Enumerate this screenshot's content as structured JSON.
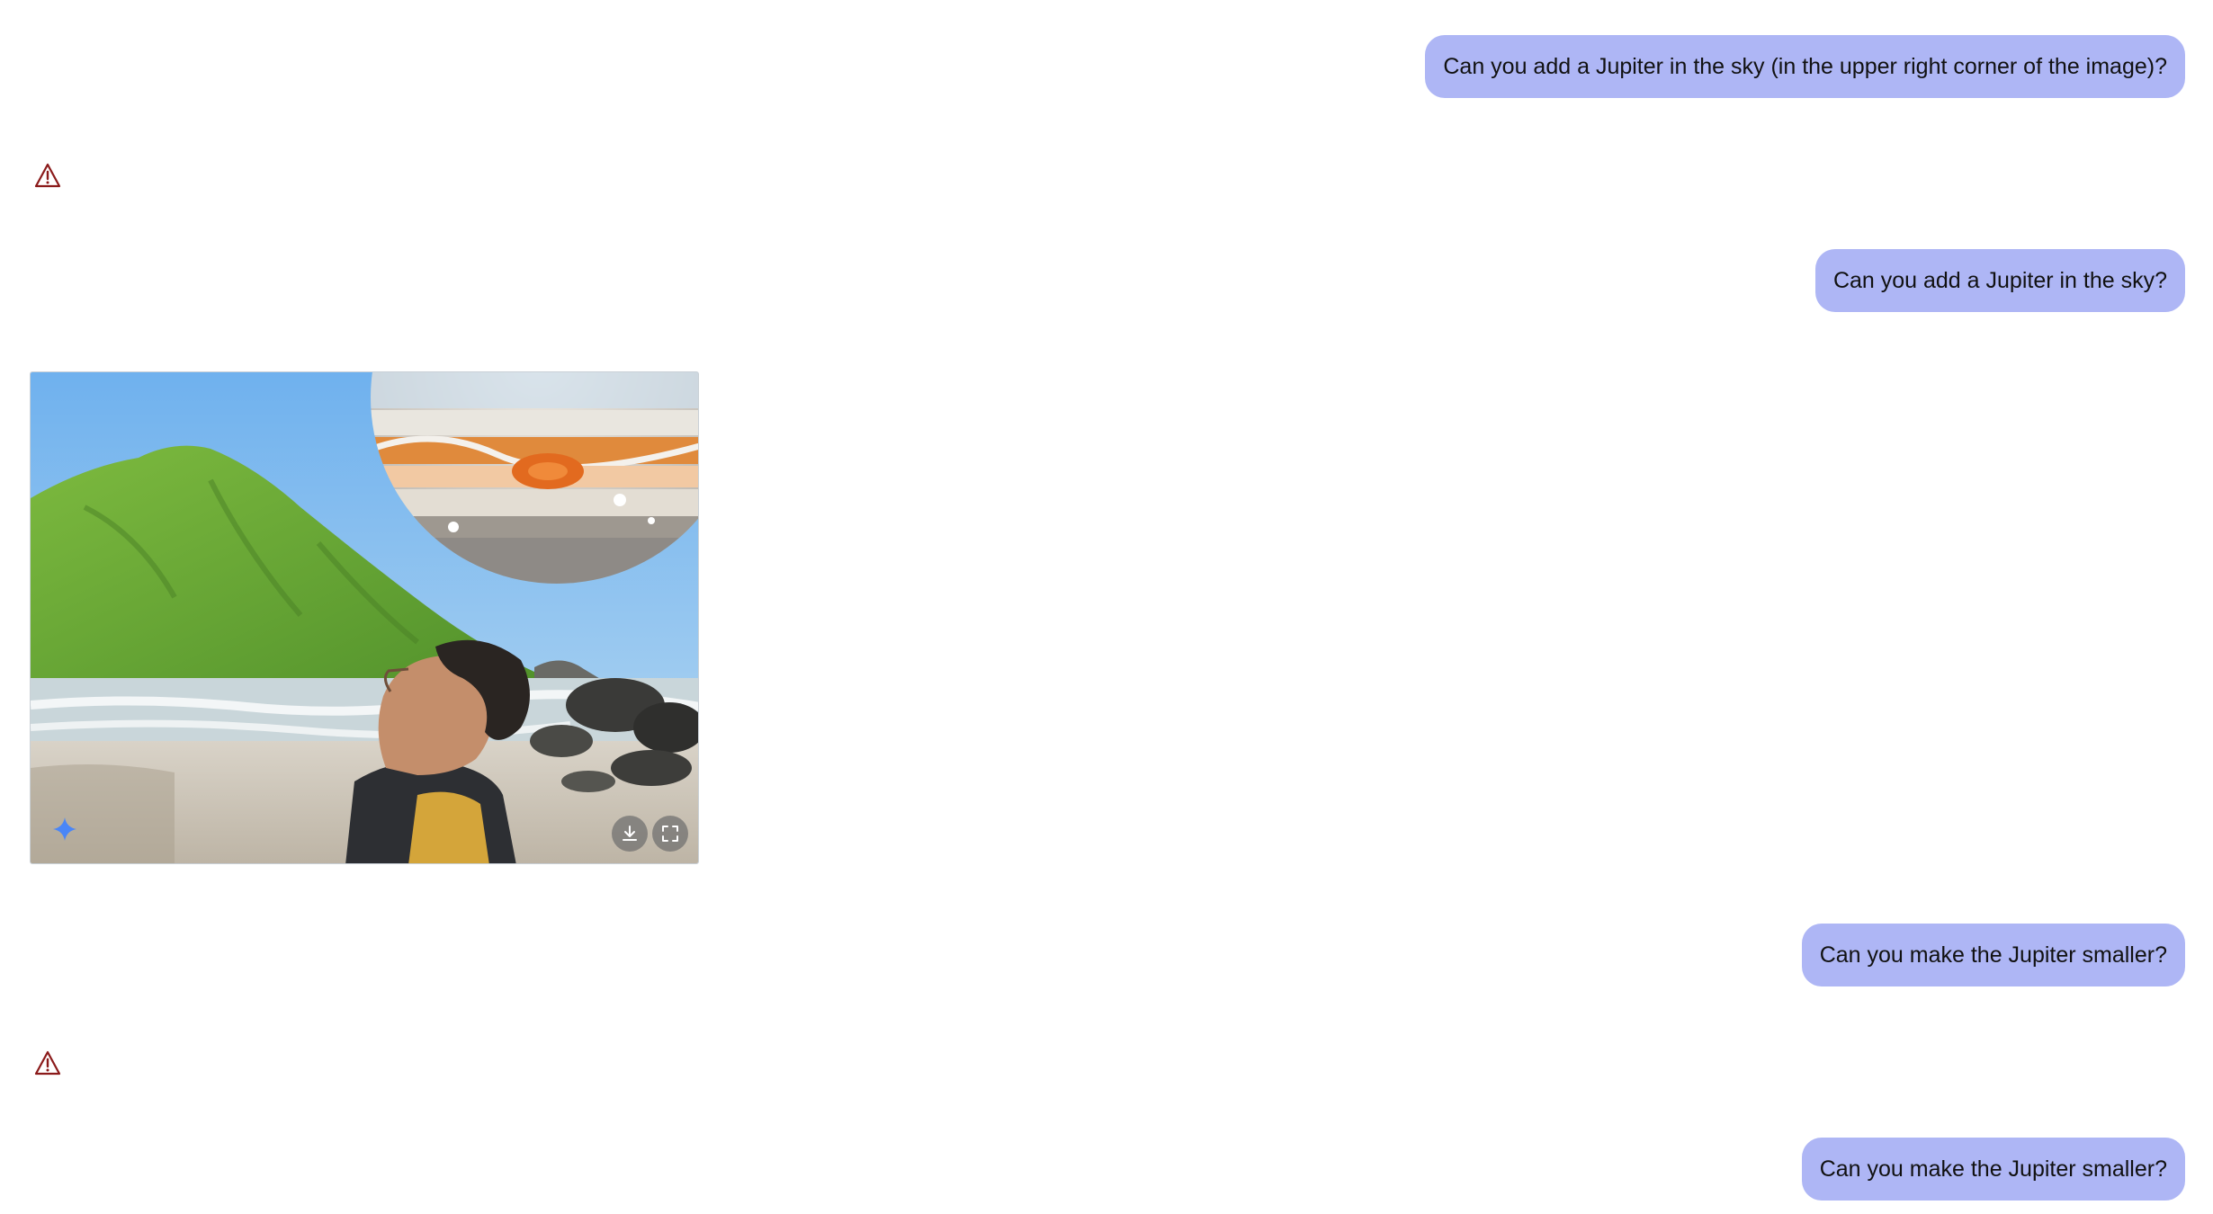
{
  "messages": [
    {
      "role": "user",
      "text": "Can you add a Jupiter in the sky (in the upper right corner of the image)?"
    },
    {
      "role": "assistant",
      "type": "error",
      "icon": "warning-icon"
    },
    {
      "role": "user",
      "text": "Can you add a Jupiter in the sky?"
    },
    {
      "role": "assistant",
      "type": "image",
      "icons": [
        "sparkle-icon",
        "download-icon",
        "fullscreen-icon"
      ]
    },
    {
      "role": "user",
      "text": "Can you make the Jupiter smaller?"
    },
    {
      "role": "assistant",
      "type": "error",
      "icon": "warning-icon"
    },
    {
      "role": "user",
      "text": "Can you make the Jupiter smaller?"
    }
  ],
  "colors": {
    "user_bubble": "#aeb6f5",
    "warning": "#8b1a1a",
    "sparkle": "#4a86f7"
  }
}
